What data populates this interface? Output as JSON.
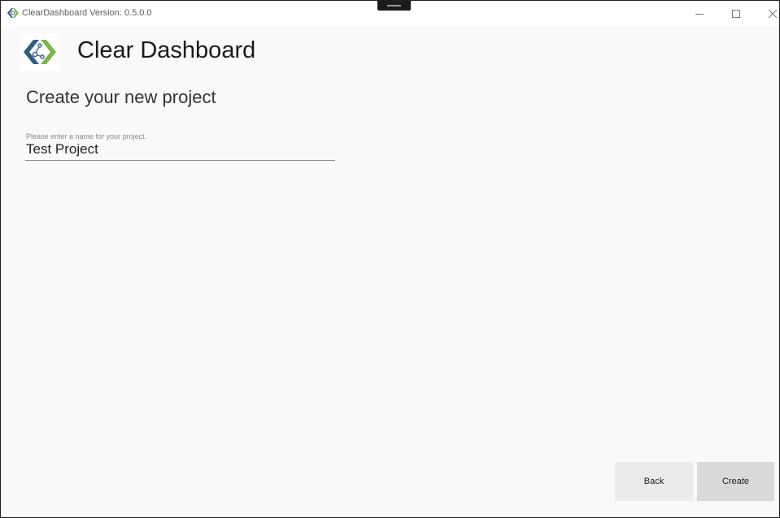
{
  "window": {
    "title": "ClearDashboard Version: 0.5.0.0",
    "controls": [
      "minimize-icon",
      "maximize-icon",
      "close-icon"
    ]
  },
  "header": {
    "app_name": "Clear Dashboard",
    "logo_icon": "clear-dashboard-logo-icon"
  },
  "page": {
    "title": "Create your new project"
  },
  "project_name_field": {
    "hint": "Please enter a name for your project.",
    "value": "Test Project"
  },
  "footer": {
    "back_label": "Back",
    "create_label": "Create"
  },
  "colors": {
    "logo_blue": "#2f5d87",
    "logo_green": "#7ab648",
    "background": "#f9f9f9",
    "back_button": "#ebebeb",
    "create_button": "#d9d9d9"
  }
}
